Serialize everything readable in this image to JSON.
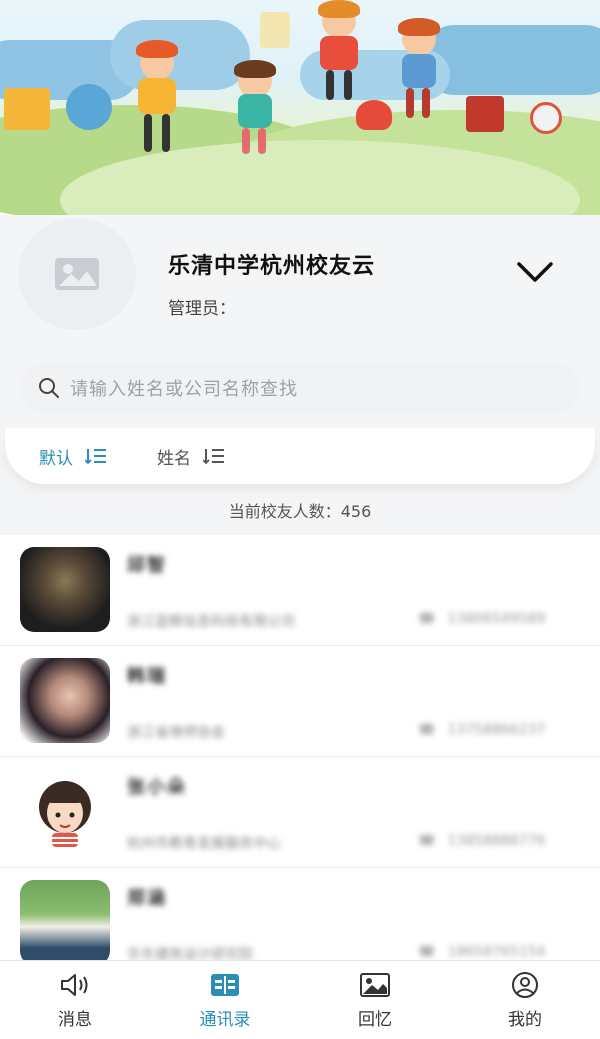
{
  "header": {
    "org_name": "乐清中学杭州校友云",
    "admin_label": "管理员：",
    "expand_icon": "chevron-down-icon"
  },
  "search": {
    "placeholder": "请输入姓名或公司名称查找",
    "icon": "search-icon"
  },
  "sort": {
    "items": [
      {
        "label": "默认",
        "active": true
      },
      {
        "label": "姓名",
        "active": false
      }
    ]
  },
  "stats": {
    "count_text": "当前校友人数：456"
  },
  "contacts": [
    {
      "name": "邱智",
      "company": "浙江蓝鲸信息科技有限公司",
      "phone": "13806549589"
    },
    {
      "name": "韩瑞",
      "company": "浙江省律师协会",
      "phone": "13758866237"
    },
    {
      "name": "张小朵",
      "company": "杭州市教育发展服务中心",
      "phone": "13858888776"
    },
    {
      "name": "郑涵",
      "company": "华东建筑设计研究院",
      "phone": "18658765154"
    }
  ],
  "tabs": [
    {
      "label": "消息",
      "icon": "speaker-icon",
      "active": false
    },
    {
      "label": "通讯录",
      "icon": "contacts-icon",
      "active": true
    },
    {
      "label": "回忆",
      "icon": "picture-icon",
      "active": false
    },
    {
      "label": "我的",
      "icon": "user-icon",
      "active": false
    }
  ],
  "colors": {
    "accent": "#2a8fb6",
    "background": "#f4f5f7"
  }
}
